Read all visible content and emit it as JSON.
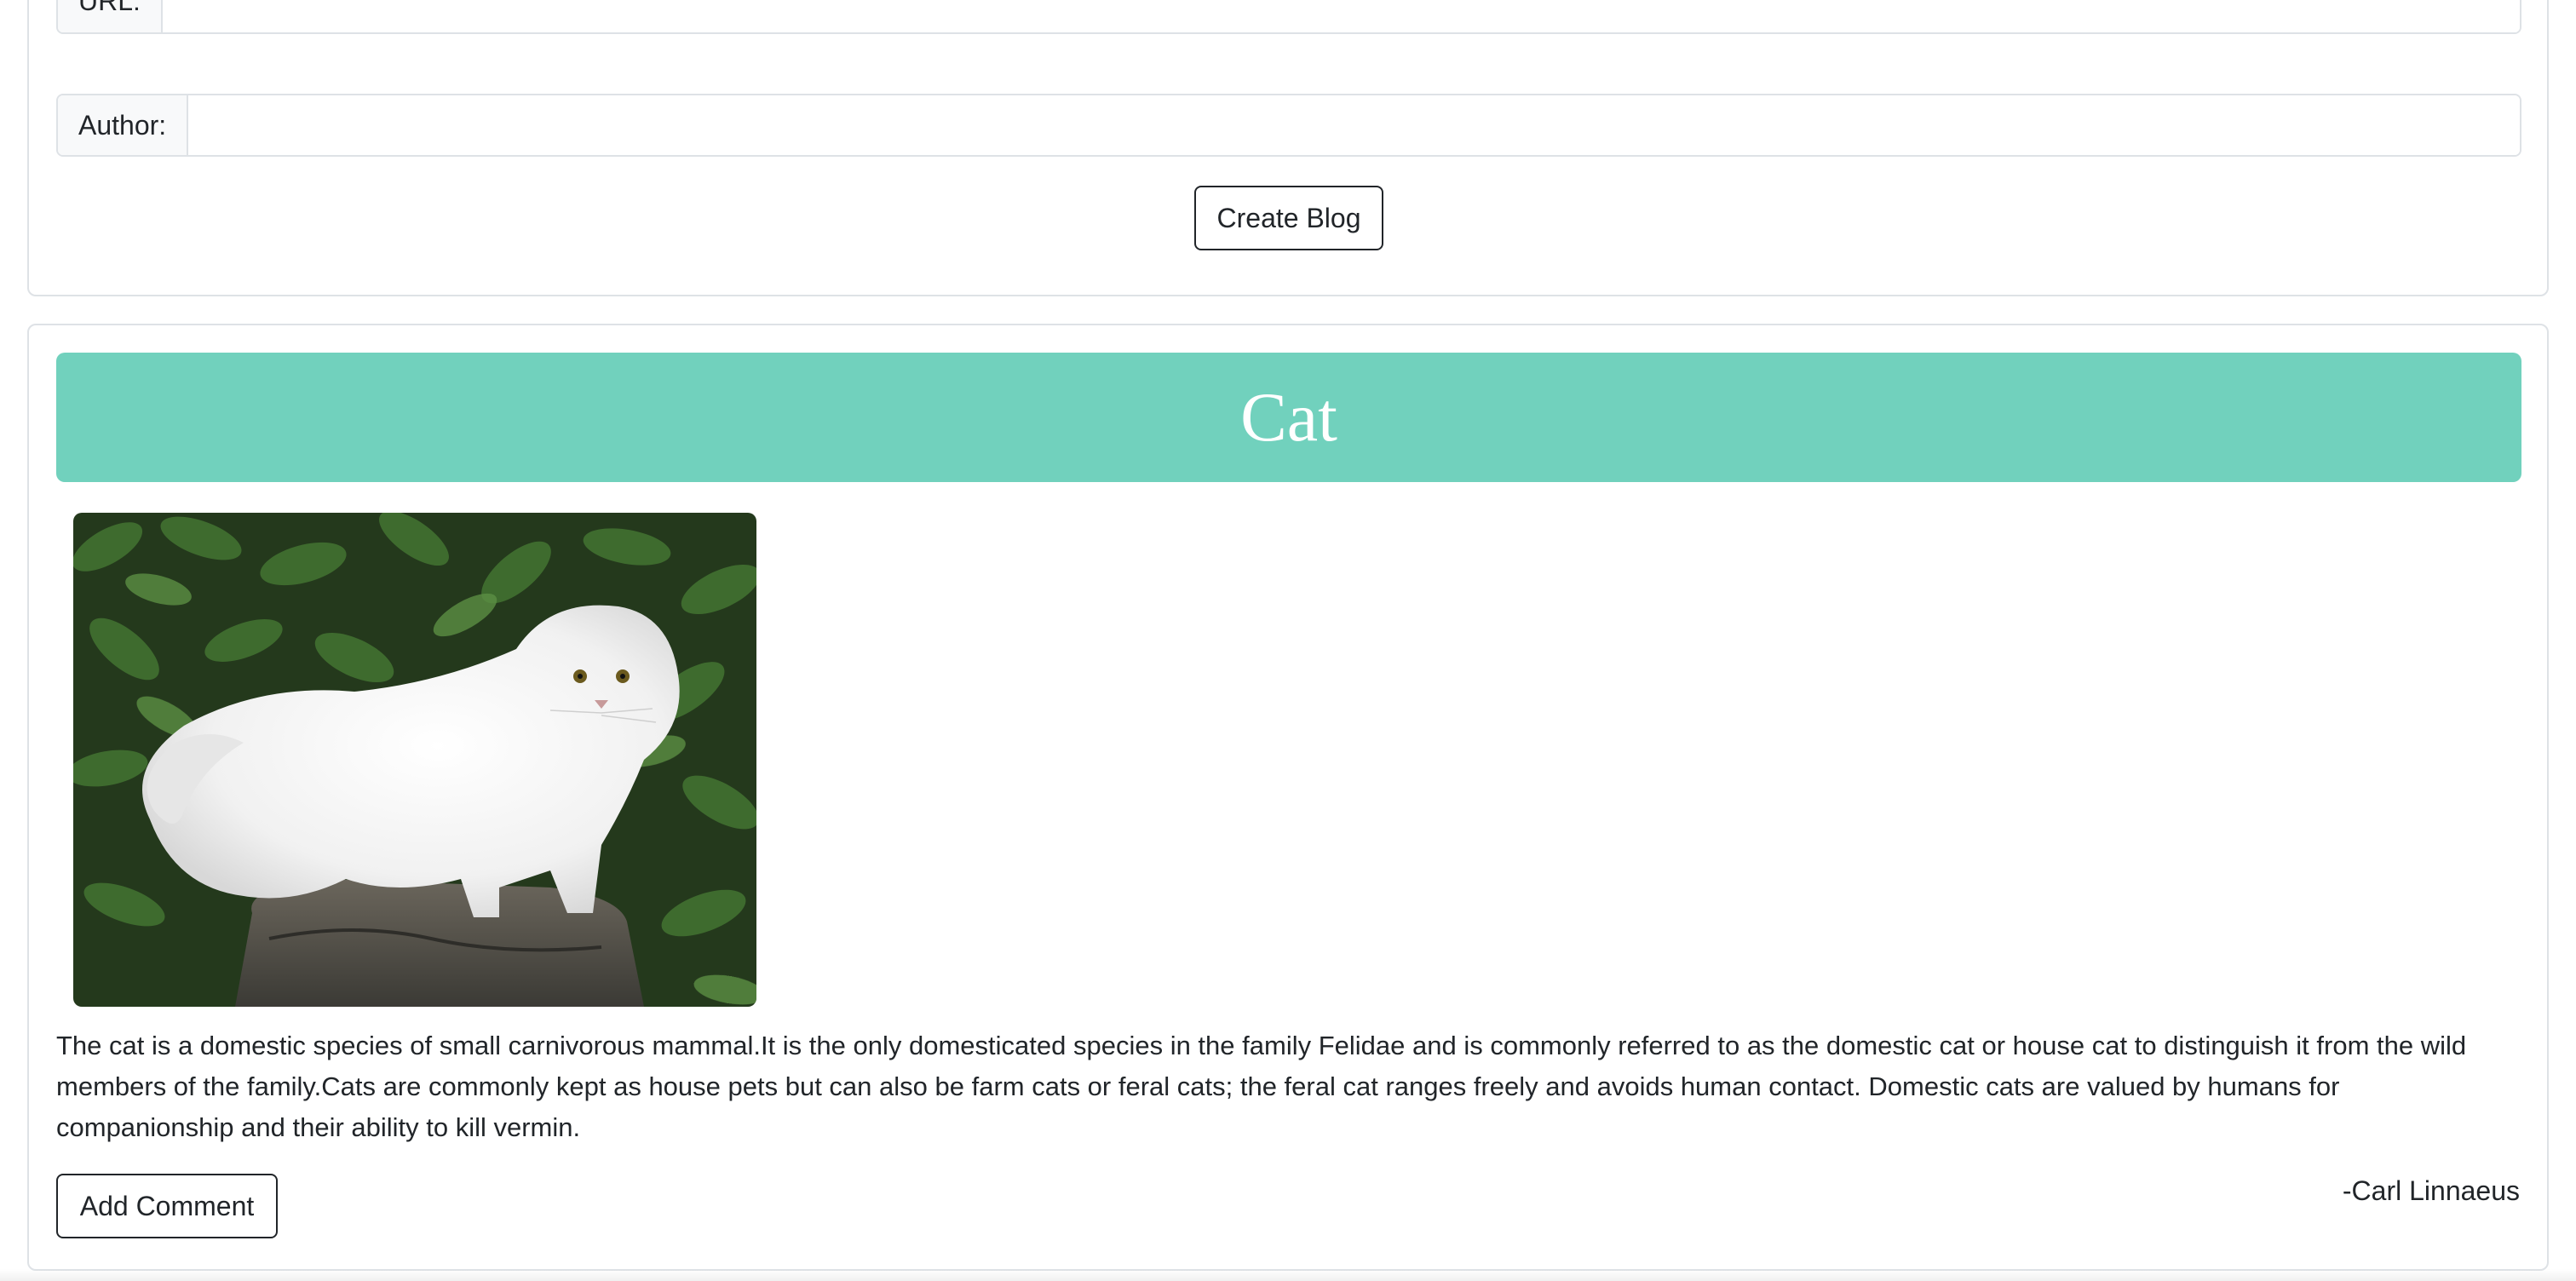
{
  "form": {
    "url_label": "URL:",
    "url_value": "",
    "author_label": "Author:",
    "author_value": "",
    "create_button": "Create Blog"
  },
  "blog": {
    "title": "Cat",
    "image_alt": "white persian cat",
    "description": "The cat is a domestic species of small carnivorous mammal.It is the only domesticated species in the family Felidae and is commonly referred to as the domestic cat or house cat to distinguish it from the wild members of the family.Cats are commonly kept as house pets but can also be farm cats or feral cats; the feral cat ranges freely and avoids human contact. Domestic cats are valued by humans for companionship and their ability to kill vermin.",
    "add_comment_button": "Add Comment",
    "author": "-Carl Linnaeus"
  },
  "colors": {
    "title_banner": "#71d1bd",
    "border": "#dee2e6"
  }
}
